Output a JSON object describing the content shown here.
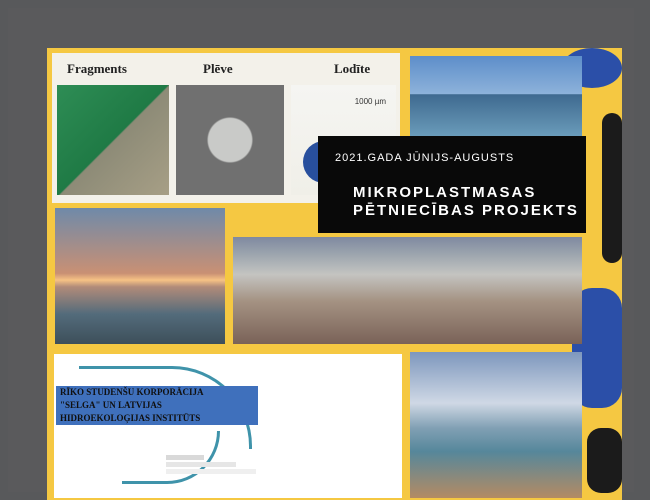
{
  "micro": {
    "labels": [
      "Fragments",
      "Plēve",
      "Lodīte"
    ],
    "scale": "1000 µm"
  },
  "title": {
    "period": "2021.GADA JŪNIJS-AUGUSTS",
    "line1": "MIKROPLASTMASAS",
    "line2": "PĒTNIECĪBAS PROJEKTS"
  },
  "map": {
    "title_line1": "RĪKO STUDENŠU KORPORĀCIJA",
    "title_line2": "\"SELGA\" UN LATVIJAS",
    "title_line3": "HIDROEKOLOĢIJAS INSTITŪTS"
  }
}
